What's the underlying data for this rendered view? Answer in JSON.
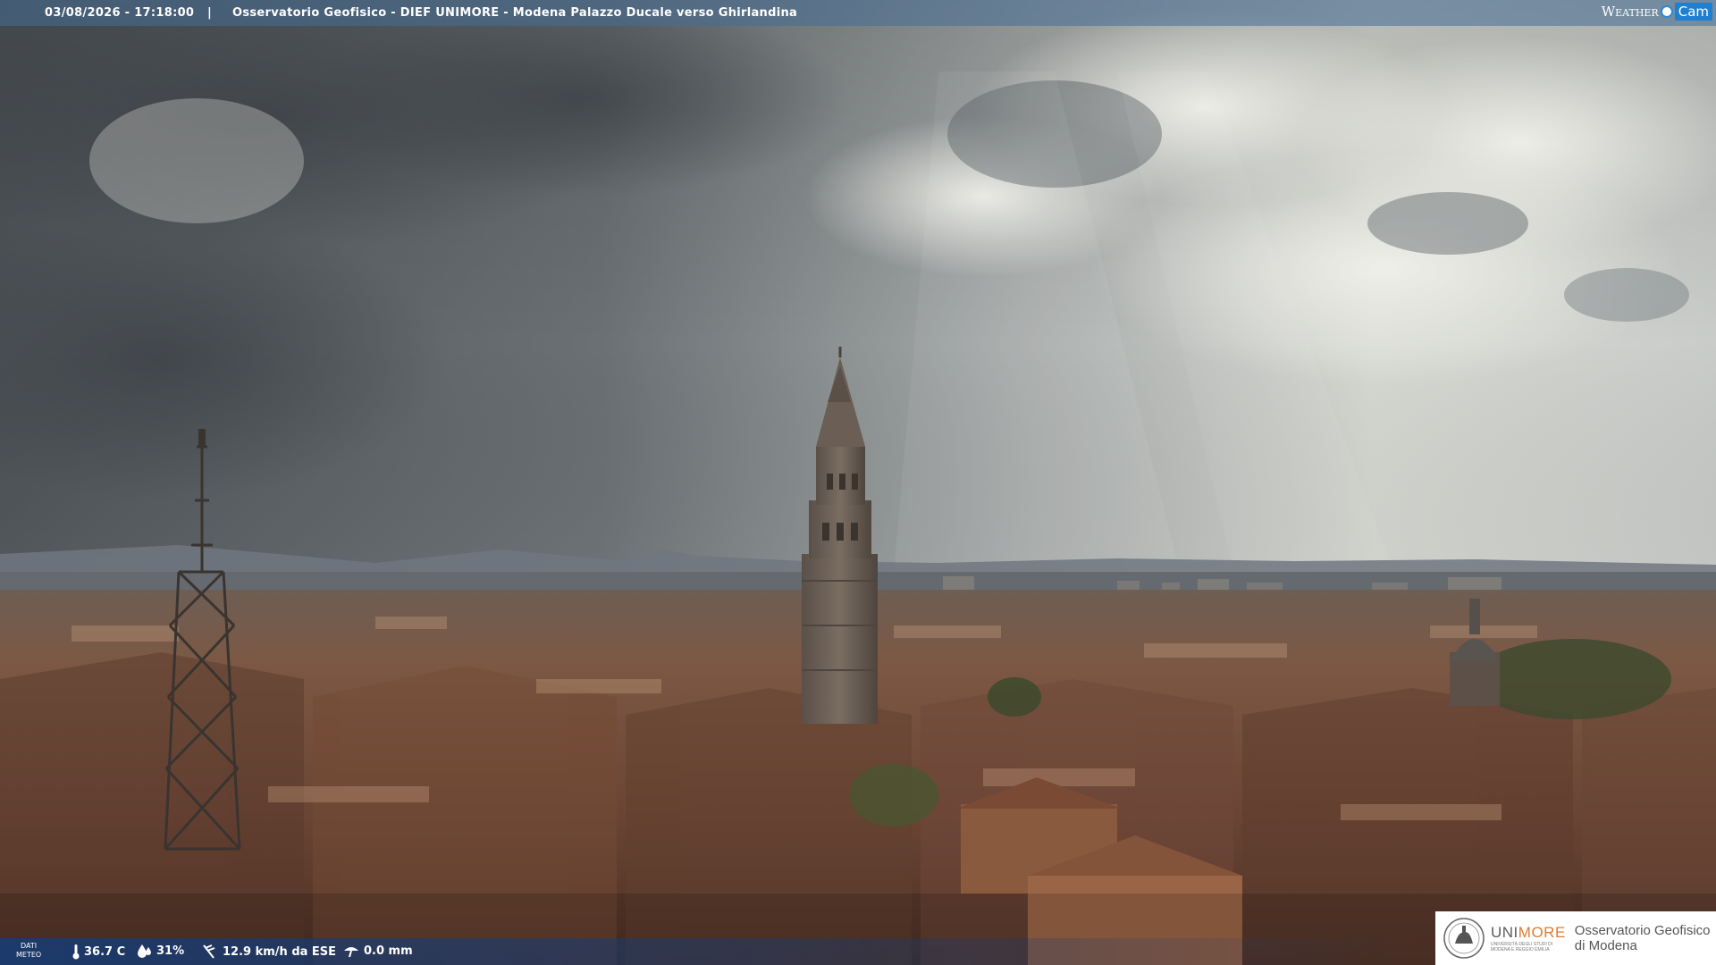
{
  "topbar": {
    "timestamp": "03/08/2026 - 17:18:00",
    "separator": "|",
    "title": "Osservatorio Geofisico - DIEF UNIMORE - Modena Palazzo Ducale verso Ghirlandina"
  },
  "brand": {
    "weather": "Weather",
    "cam": "Cam"
  },
  "weather_data": {
    "label_line1": "DATI",
    "label_line2": "METEO",
    "temperature": "36.7 C",
    "humidity": "31%",
    "wind": "12.9 km/h da ESE",
    "rain": "0.0 mm",
    "icons": [
      "thermometer-icon",
      "humidity-icon",
      "wind-icon",
      "rain-gauge-icon"
    ]
  },
  "logo": {
    "uni": "UNI",
    "more": "MORE",
    "university_subtitle": "UNIVERSITÀ DEGLI STUDI DI MODENA E REGGIO EMILIA",
    "observatory_line1": "Osservatorio Geofisico",
    "observatory_line2": "di Modena"
  },
  "colors": {
    "topbar_bg": "#466e96",
    "brand_cam": "#1f7fd1",
    "unimore_orange": "#e07b2c"
  }
}
